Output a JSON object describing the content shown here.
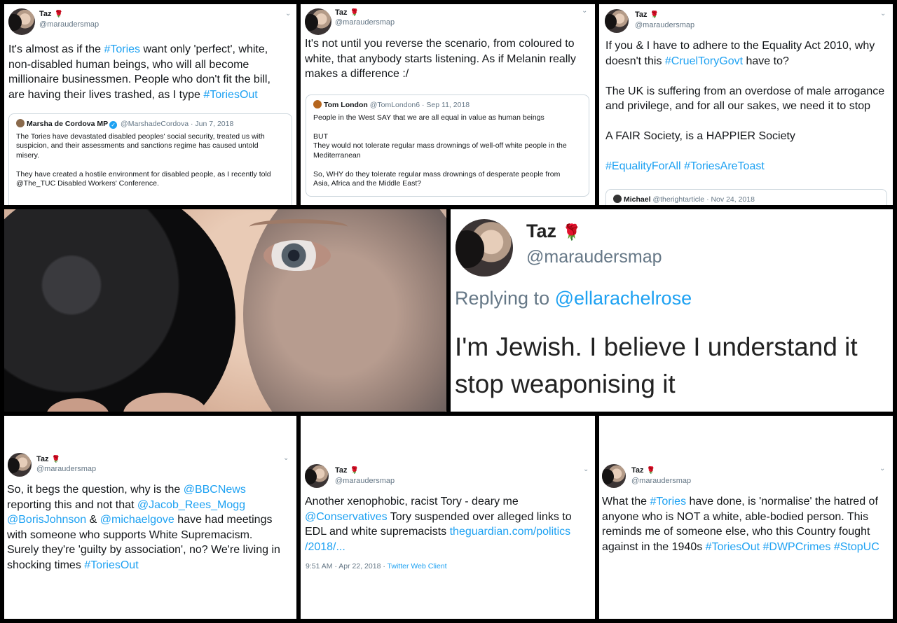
{
  "author": {
    "name": "Taz",
    "handle": "@maraudersmap",
    "rose": "🌹"
  },
  "tweets": {
    "t1": {
      "lines": [
        [
          {
            "t": "It's almost as if the "
          },
          {
            "t": "#Tories",
            "tag": true
          },
          {
            "t": " want only 'perfect', white,"
          }
        ],
        [
          {
            "t": "non-disabled human beings, who will all become"
          }
        ],
        [
          {
            "t": "millionaire businessmen.  People who don't fit the bill,"
          }
        ],
        [
          {
            "t": "are having their lives trashed, as I type "
          },
          {
            "t": "#ToriesOut",
            "tag": true
          }
        ]
      ],
      "quote": {
        "name": "Marsha de Cordova MP",
        "handle": "@MarshadeCordova",
        "date": "· Jun 7, 2018",
        "lines": [
          "The Tories have devastated disabled peoples' social security, treated us with",
          "suspicion, and their assessments and sanctions regime has caused untold",
          "misery.",
          "",
          "They have created a hostile environment for disabled people, as I recently told",
          "@The_TUC Disabled Workers' Conference."
        ]
      }
    },
    "t2": {
      "lines": [
        [
          {
            "t": "It's not until you reverse the scenario, from coloured to"
          }
        ],
        [
          {
            "t": "white, that anybody starts listening.  As if Melanin really"
          }
        ],
        [
          {
            "t": "makes a difference :/"
          }
        ]
      ],
      "quote": {
        "name": "Tom London",
        "handle": "@TomLondon6",
        "date": "· Sep 11, 2018",
        "lines": [
          "People in the West SAY that we are all equal in value as human beings",
          "",
          "BUT",
          "They would not tolerate regular mass drownings of well-off white people in the",
          "Mediterranean",
          "",
          "So, WHY do they tolerate regular mass drownings of desperate people from",
          "Asia, Africa and the Middle East?"
        ]
      }
    },
    "t3": {
      "lines": [
        [
          {
            "t": "If you & I have to adhere to the Equality Act 2010, why"
          }
        ],
        [
          {
            "t": "doesn't this "
          },
          {
            "t": "#CruelToryGovt",
            "tag": true
          },
          {
            "t": " have to?"
          }
        ],
        [
          {
            "t": ""
          }
        ],
        [
          {
            "t": "The UK is suffering from an overdose of male arrogance"
          }
        ],
        [
          {
            "t": "and privilege, and for all our sakes, we need it to stop"
          }
        ],
        [
          {
            "t": ""
          }
        ],
        [
          {
            "t": "A FAIR Society, is a HAPPIER Society"
          }
        ],
        [
          {
            "t": ""
          }
        ],
        [
          {
            "t": "#EqualityForAll",
            "tag": true
          },
          {
            "t": " "
          },
          {
            "t": "#ToriesAreToast",
            "tag": true
          }
        ]
      ],
      "quote": {
        "name": "Michael",
        "handle": "@therightarticle",
        "date": "· Nov 24, 2018",
        "lines": []
      }
    },
    "t4": {
      "lines": [
        [
          {
            "t": "So, it begs the question, why is the "
          },
          {
            "t": "@BBCNews",
            "tag": true
          }
        ],
        [
          {
            "t": "reporting this and not that "
          },
          {
            "t": "@Jacob_Rees_Mogg",
            "tag": true
          }
        ],
        [
          {
            "t": "@BorisJohnson",
            "tag": true
          },
          {
            "t": " & "
          },
          {
            "t": "@michaelgove",
            "tag": true
          },
          {
            "t": " have had meetings"
          }
        ],
        [
          {
            "t": "with someone who supports White Supremacism."
          }
        ],
        [
          {
            "t": "Surely they're 'guilty by association', no?  We're living in"
          }
        ],
        [
          {
            "t": "shocking times "
          },
          {
            "t": "#ToriesOut",
            "tag": true
          }
        ]
      ]
    },
    "t5": {
      "lines": [
        [
          {
            "t": "Another xenophobic, racist Tory - deary me"
          }
        ],
        [
          {
            "t": "@Conservatives",
            "tag": true
          },
          {
            "t": " Tory suspended over alleged links to"
          }
        ],
        [
          {
            "t": "EDL and white supremacists "
          },
          {
            "t": "theguardian.com/politics",
            "tag": true
          }
        ],
        [
          {
            "t": "/2018/...",
            "tag": true
          }
        ]
      ],
      "meta": {
        "time": "9:51 AM · Apr 22, 2018 · ",
        "client": "Twitter Web Client"
      }
    },
    "t6": {
      "lines": [
        [
          {
            "t": "What the "
          },
          {
            "t": "#Tories",
            "tag": true
          },
          {
            "t": " have done, is 'normalise' the hatred of"
          }
        ],
        [
          {
            "t": "anyone who is NOT a white, able-bodied person.  This"
          }
        ],
        [
          {
            "t": "reminds me of someone else, who this Country fought"
          }
        ],
        [
          {
            "t": "against in the 1940s "
          },
          {
            "t": "#ToriesOut",
            "tag": true
          },
          {
            "t": " "
          },
          {
            "t": "#DWPCrimes",
            "tag": true
          },
          {
            "t": " "
          },
          {
            "t": "#StopUC",
            "tag": true
          }
        ]
      ]
    }
  },
  "zoom": {
    "name": "Taz",
    "handle": "@maraudersmap",
    "replying_prefix": "Replying to ",
    "replying_to": "@ellarachelrose",
    "line1": "I'm Jewish. I believe I understand it",
    "line2": "stop weaponising it"
  },
  "icons": {
    "chevron": "chevron-down-icon",
    "verified": "verified-badge-icon",
    "rose": "rose-emoji-icon"
  },
  "colors": {
    "link": "#1da1f2",
    "text": "#14171a",
    "muted": "#657786",
    "rose": "#c8102e",
    "border": "#ccd6dd"
  }
}
